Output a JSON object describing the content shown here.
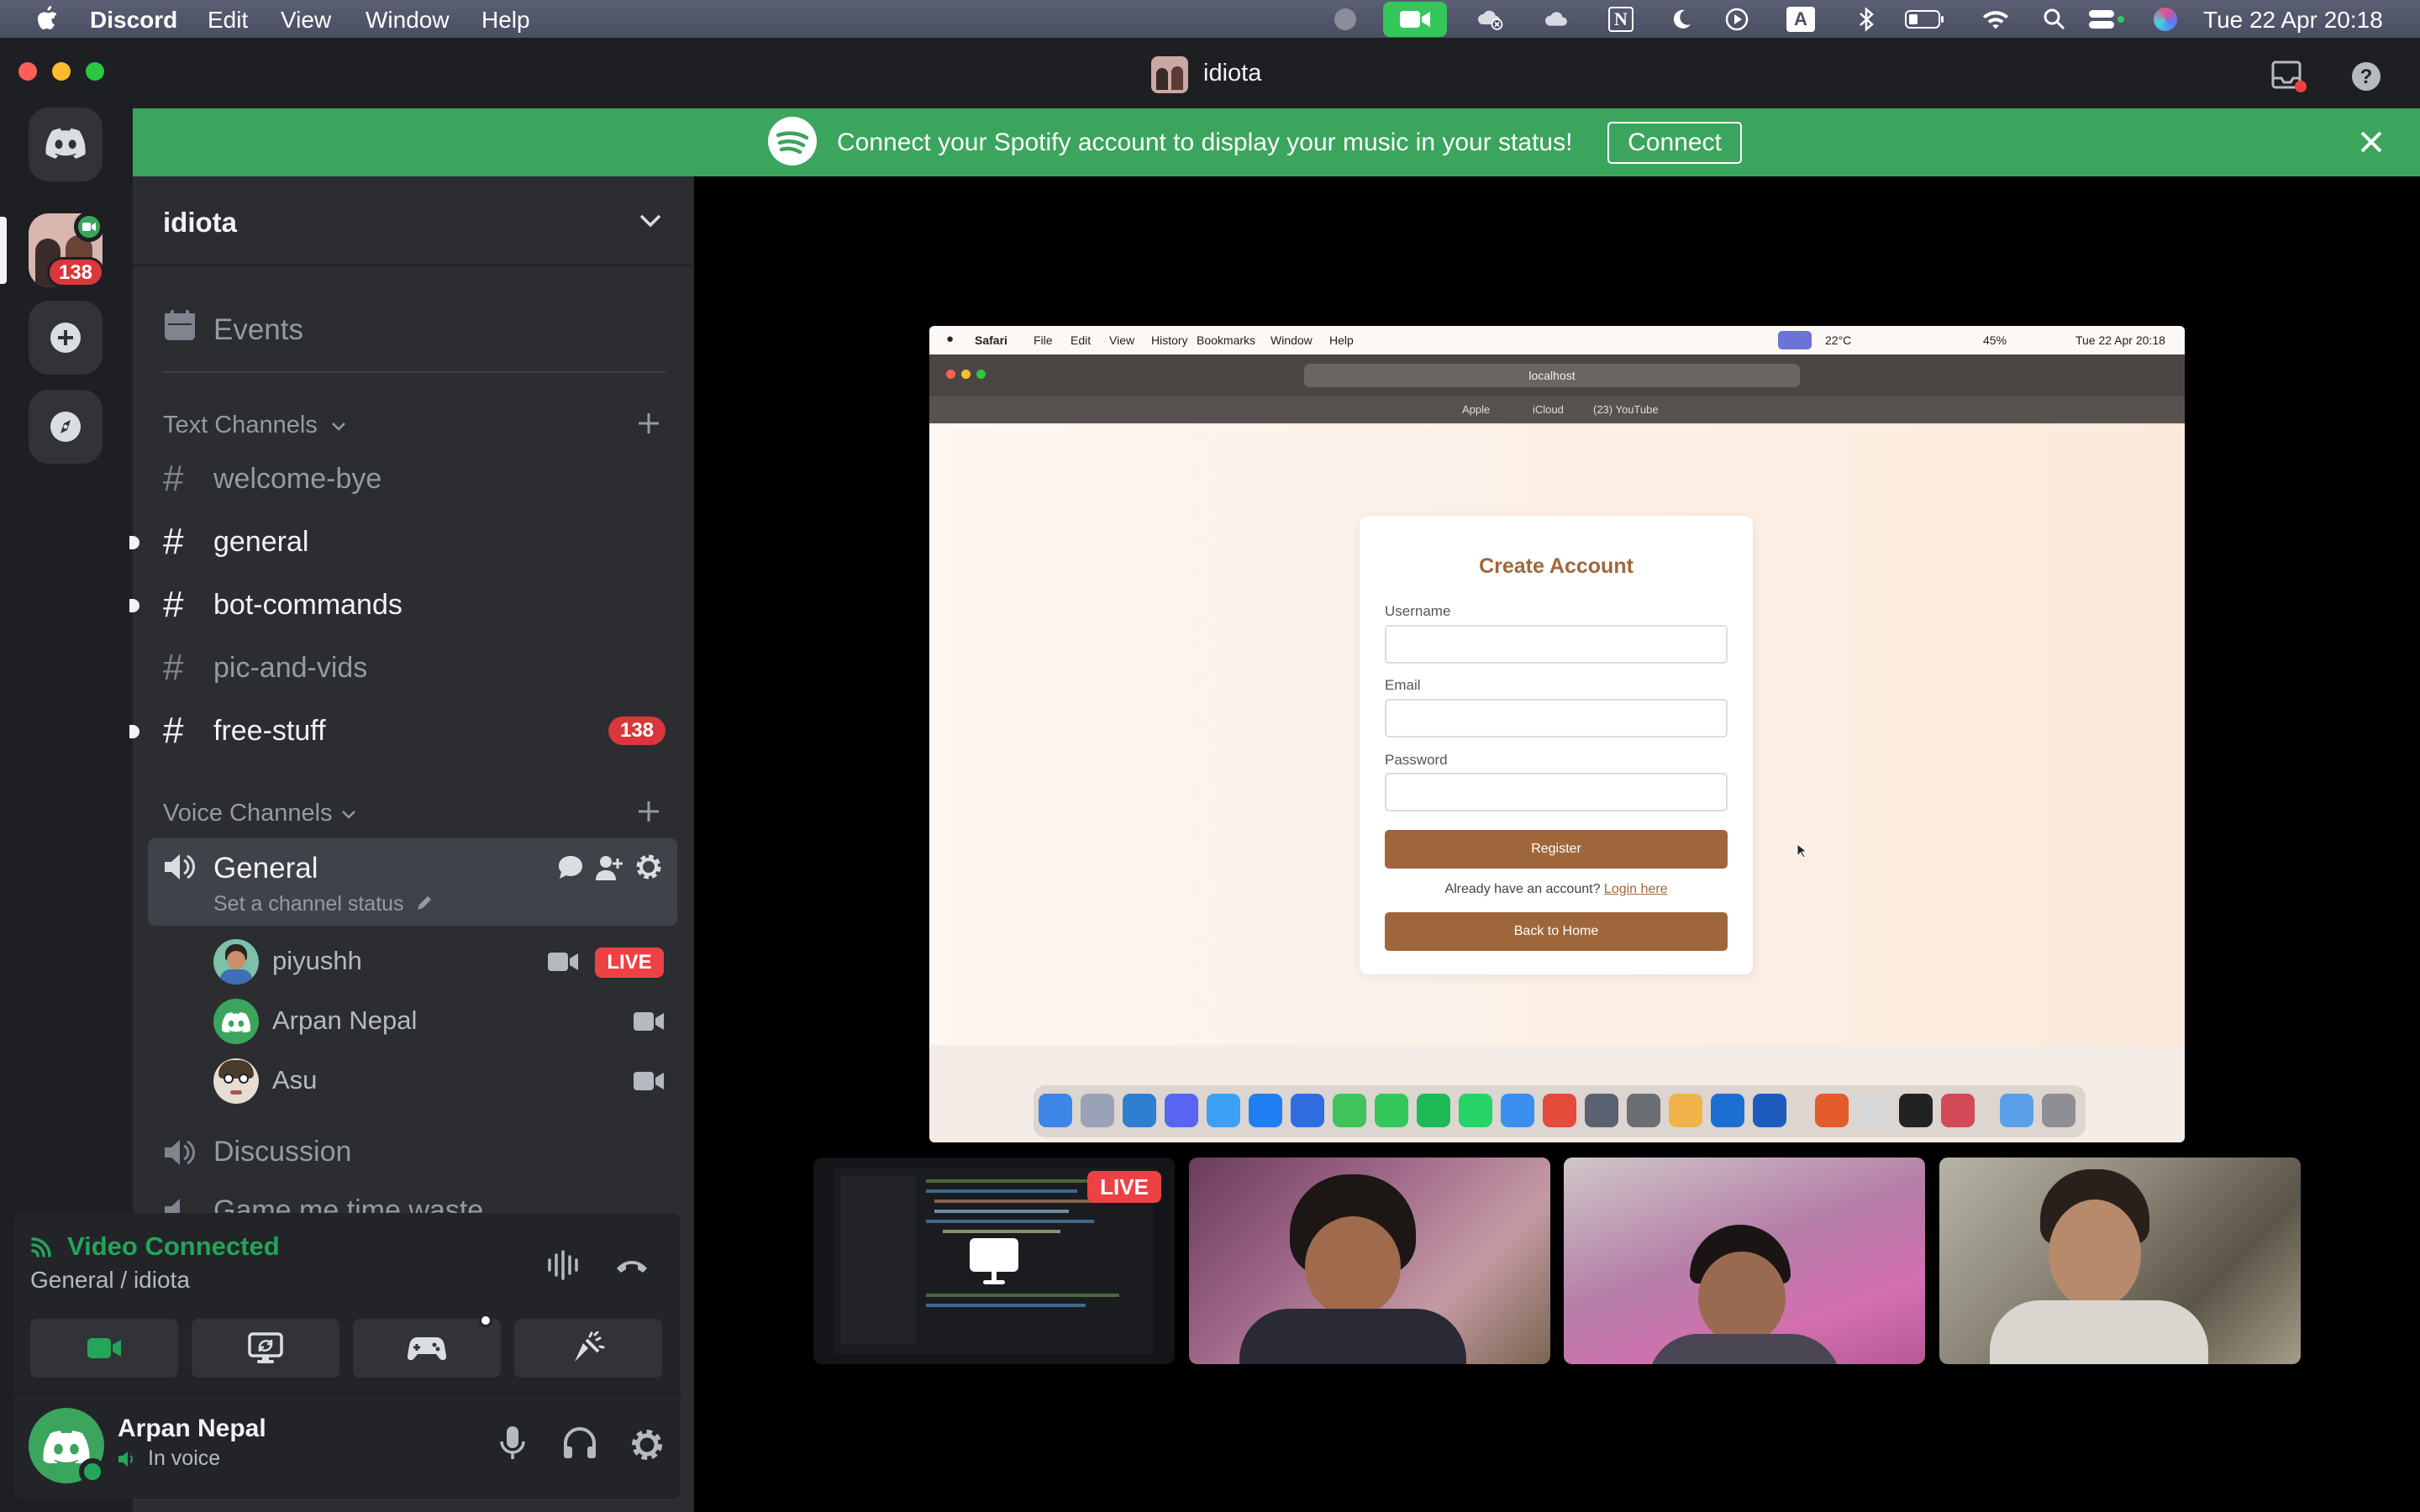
{
  "menubar": {
    "app": "Discord",
    "items": [
      "Edit",
      "View",
      "Window",
      "Help"
    ],
    "datetime": "Tue 22 Apr  20:18"
  },
  "window": {
    "title": "idiota"
  },
  "servers": {
    "badge": "138"
  },
  "banner": {
    "text": "Connect your Spotify account to display your music in your status!",
    "button": "Connect"
  },
  "sidebar": {
    "server_name": "idiota",
    "events": "Events",
    "text_category": "Text Channels",
    "text_channels": [
      {
        "name": "welcome-bye"
      },
      {
        "name": "general"
      },
      {
        "name": "bot-commands"
      },
      {
        "name": "pic-and-vids"
      },
      {
        "name": "free-stuff",
        "badge": "138"
      }
    ],
    "voice_category": "Voice Channels",
    "voice_channel": {
      "name": "General",
      "status": "Set a channel status",
      "users": [
        {
          "name": "piyushh",
          "live": "LIVE"
        },
        {
          "name": "Arpan Nepal"
        },
        {
          "name": "Asu"
        }
      ]
    },
    "discussion": "Discussion",
    "cut_channel": "Game me time waste"
  },
  "voice_panel": {
    "status": "Video Connected",
    "channel": "General / idiota",
    "user": "Arpan Nepal",
    "user_status": "In voice"
  },
  "shared_screen": {
    "menubar": {
      "app": "Safari",
      "items": [
        "File",
        "Edit",
        "View",
        "History",
        "Bookmarks",
        "Window",
        "Help"
      ],
      "temp": "22°C",
      "battery": "45%",
      "datetime": "Tue 22 Apr  20:18"
    },
    "url": "localhost",
    "favorites": [
      "Apple",
      "iCloud",
      "(23) YouTube"
    ],
    "form": {
      "title": "Create Account",
      "username_label": "Username",
      "email_label": "Email",
      "password_label": "Password",
      "register": "Register",
      "have_account": "Already have an account?",
      "login_link": "Login here",
      "back_home": "Back to Home"
    }
  },
  "thumbnails": {
    "live": "LIVE"
  },
  "colors": {
    "accent_green": "#3ba55d",
    "live_red": "#ed4245",
    "sidebar": "#2b2d31",
    "form_button": "#a0663b"
  }
}
